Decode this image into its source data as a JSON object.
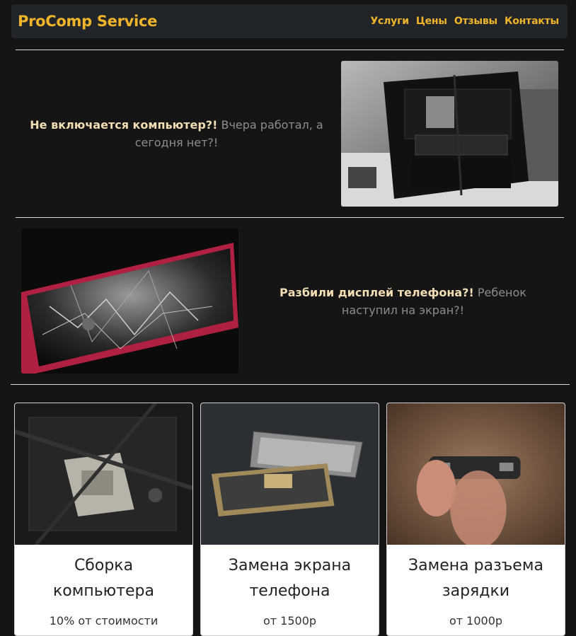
{
  "navbar": {
    "brand": "ProComp Service",
    "links": [
      "Услуги",
      "Цены",
      "Отзывы",
      "Контакты"
    ]
  },
  "promo1": {
    "bold": "Не включается компьютер?!",
    "text": " Вчера работал, а сегодня нет?!"
  },
  "promo2": {
    "bold": "Разбили дисплей телефона?!",
    "text": " Ребенок наступил на экран?!"
  },
  "cards": [
    {
      "title": "Сборка компьютера",
      "price": "10% от стоимости"
    },
    {
      "title": "Замена экрана телефона",
      "price": "от 1500р"
    },
    {
      "title": "Замена разъема зарядки",
      "price": "от 1000р"
    }
  ],
  "colors": {
    "accent": "#f0b42a",
    "background": "#151515",
    "navbar": "#212529"
  }
}
